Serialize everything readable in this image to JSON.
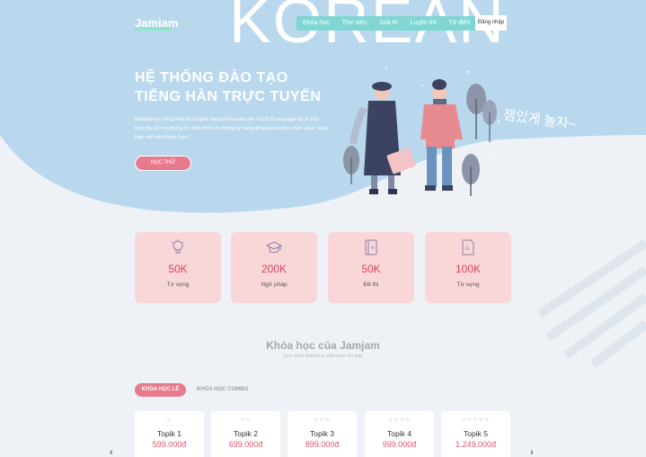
{
  "header": {
    "logo": "Jamjam",
    "big_word": "KOREAN",
    "nav": [
      "Khóa học",
      "Thư viện",
      "Giải trí",
      "Luyện thi",
      "Từ điển"
    ],
    "login": "Đăng nhập"
  },
  "hero": {
    "title_line1": "HỆ THỐNG ĐÀO TẠO",
    "title_line2": "TIẾNG HÀN TRỰC TUYẾN",
    "description": "Website học tiếng Hàn trực tuyến JamJamKorean.com của ICOLanguage được tích hợp đầy đủ mọi thông tin, kiến thức và những kỹ năng để giúp các bạn chinh phục tiếng Hàn một cách hoàn hảo !",
    "cta": "HỌC THỬ",
    "korean_line1": "잼있게 놀자~",
    "korean_line2": ""
  },
  "stats": [
    {
      "icon": "lightbulb-icon",
      "value": "50K",
      "label": "Từ vựng"
    },
    {
      "icon": "graduation-cap-icon",
      "value": "200K",
      "label": "Ngữ pháp"
    },
    {
      "icon": "book-icon",
      "value": "50K",
      "label": "Đề thi"
    },
    {
      "icon": "document-icon",
      "value": "100K",
      "label": "Từ vựng"
    }
  ],
  "courses_section": {
    "title": "Khóa học của Jamjam",
    "subtitle": "Lựa chọn khóa học phù hợp với bạn",
    "tab_active": "KHÓA HỌC LẺ",
    "tab_other": "KHÓA HỌC COMBO",
    "items": [
      {
        "stars": "☆",
        "name": "Topik 1",
        "price": "599.000đ"
      },
      {
        "stars": "☆☆",
        "name": "Topik 2",
        "price": "699.000đ"
      },
      {
        "stars": "☆☆☆",
        "name": "Topik 3",
        "price": "899.000đ"
      },
      {
        "stars": "☆☆☆☆",
        "name": "Topik 4",
        "price": "999.000đ"
      },
      {
        "stars": "☆☆☆☆☆",
        "name": "Topik 5",
        "price": "1.249.000đ"
      }
    ],
    "prev": "‹",
    "next": "›"
  },
  "colors": {
    "hero_blue": "#b9d8ee",
    "accent_pink": "#e87a8d",
    "nav_teal": "#7fd6d2",
    "card_pink": "#f9d7d9",
    "price_red": "#e0556c"
  }
}
